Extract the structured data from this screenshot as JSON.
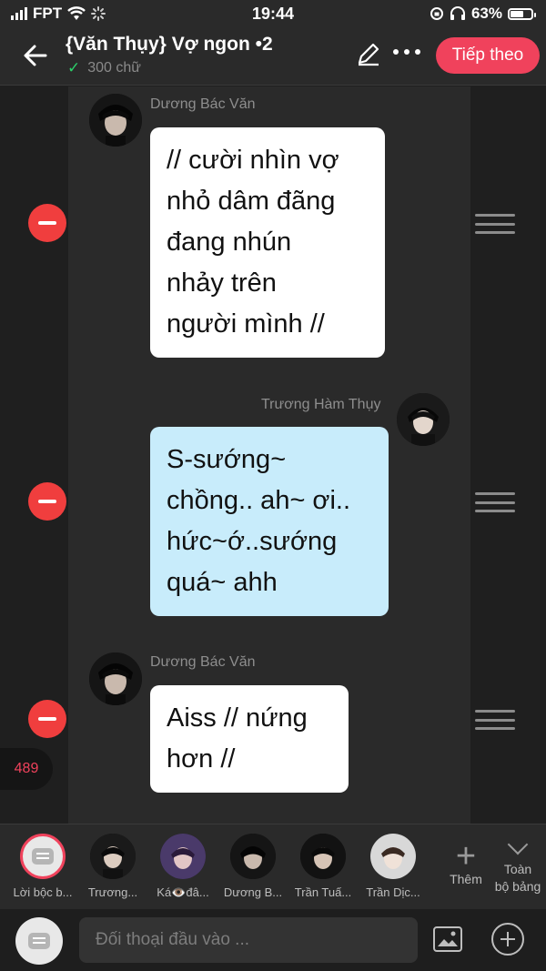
{
  "status_bar": {
    "carrier": "FPT",
    "time": "19:44",
    "battery": "63%",
    "battery_level": 0.63,
    "icons": [
      "signal-icon",
      "wifi-icon",
      "loading-icon",
      "rotation-lock-icon",
      "headphones-icon",
      "battery-icon"
    ]
  },
  "header": {
    "title": "{Văn Thụy} Vợ ngon •2",
    "word_count": "300 chữ",
    "next_label": "Tiếp theo"
  },
  "messages": [
    {
      "sender": "Dương Bác Văn",
      "side": "left",
      "color": "#ffffff",
      "lines": [
        "// cười nhìn vợ",
        "nhỏ dâm đãng",
        "đang nhún",
        "nhảy trên",
        "người mình //"
      ]
    },
    {
      "sender": "Trương Hàm Thụy",
      "side": "right",
      "color": "#c8ecfb",
      "lines": [
        "S-sướng~",
        "chồng.. ah~ ơi..",
        "hức~ớ..sướng",
        "quá~ ahh"
      ]
    },
    {
      "sender": "Dương Bác Văn",
      "side": "left",
      "color": "#ffffff",
      "lines": [
        "Aiss // nứng",
        "hơn //"
      ]
    }
  ],
  "count_badge": "489",
  "characters": [
    {
      "name": "Lời bộc b..."
    },
    {
      "name": "Trương..."
    },
    {
      "name": "Ká👁️đâ..."
    },
    {
      "name": "Dương B..."
    },
    {
      "name": "Trần Tuấ..."
    },
    {
      "name": "Trần Dịc..."
    }
  ],
  "add_character_label": "Thêm",
  "all_board_label_1": "Toàn",
  "all_board_label_2": "bộ bảng",
  "input": {
    "placeholder": "Đối thoại đầu vào ..."
  },
  "colors": {
    "accent": "#f0425c",
    "remove": "#f03e3e",
    "bubble_white": "#ffffff",
    "bubble_blue": "#c8ecfb"
  }
}
